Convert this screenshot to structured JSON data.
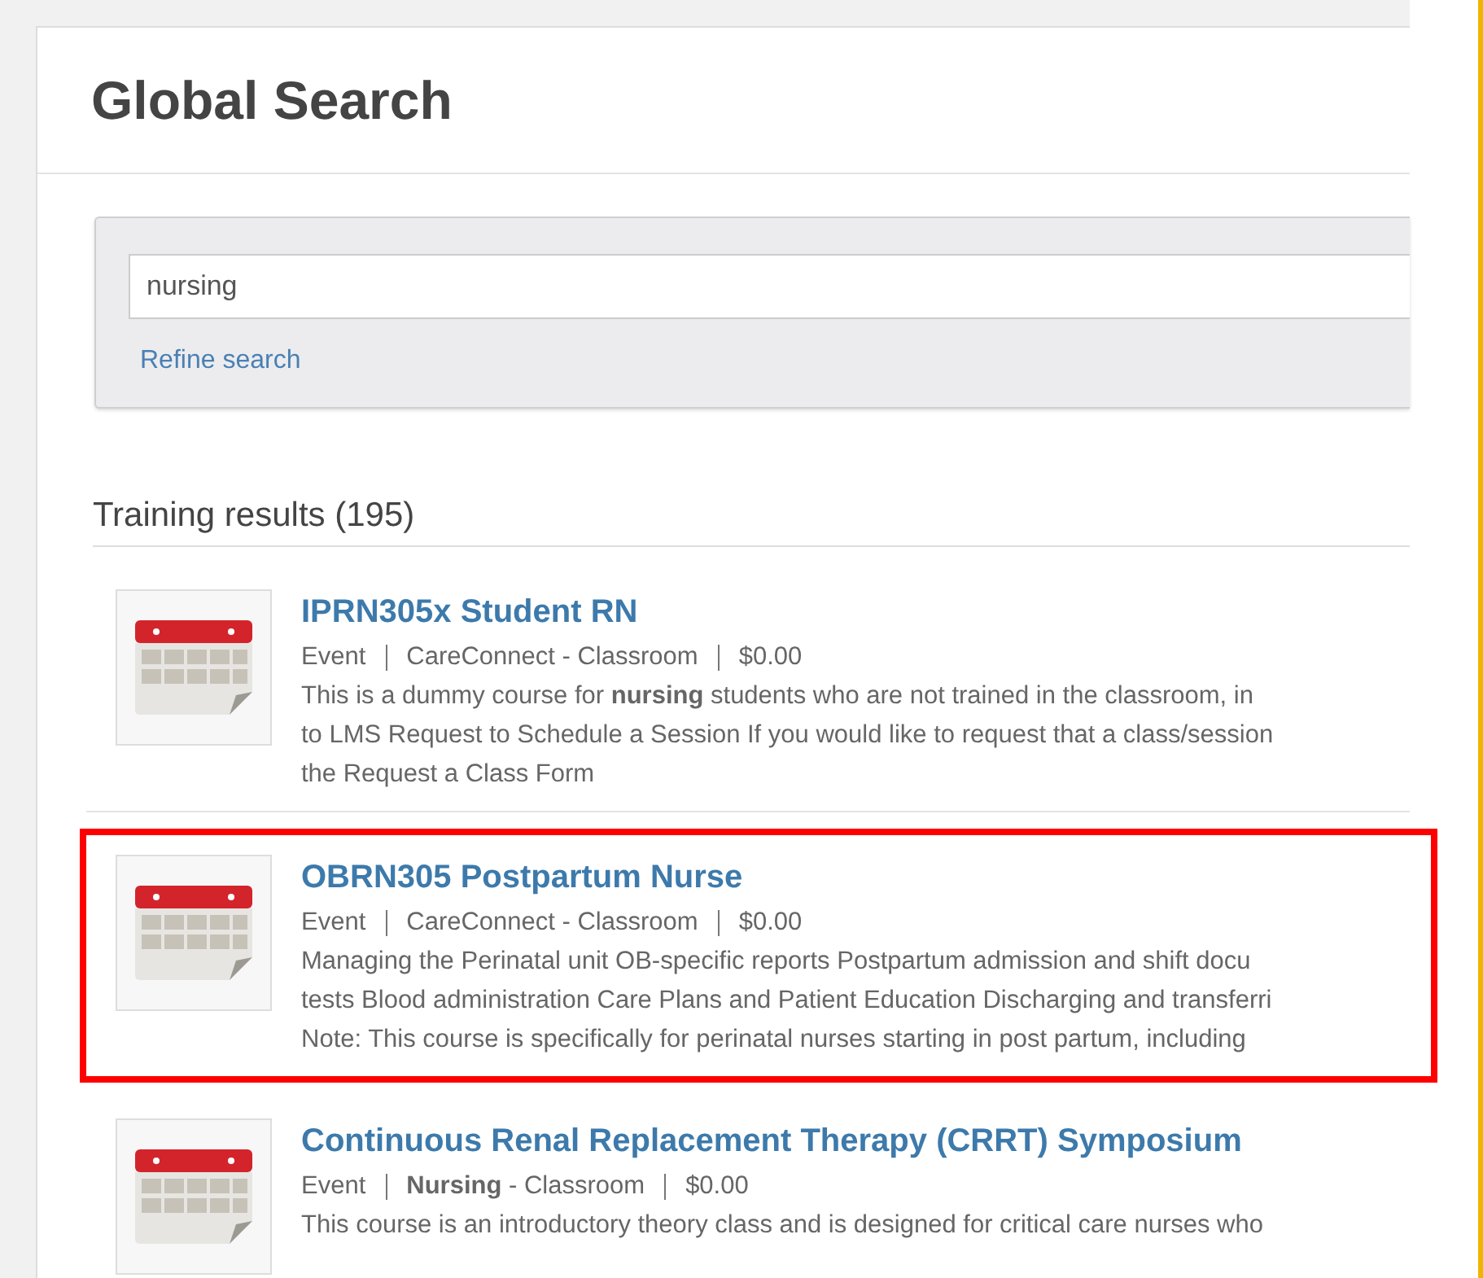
{
  "page": {
    "title": "Global Search"
  },
  "search": {
    "value": "nursing",
    "refine_link": "Refine search"
  },
  "results_heading": "Training results (195)",
  "results": [
    {
      "title": "IPRN305x Student RN",
      "meta": [
        "Event",
        "CareConnect - Classroom",
        "$0.00"
      ],
      "highlighted": false,
      "description": [
        "This is a dummy course for **nursing** students who are not trained in the classroom, in",
        "to LMS Request to Schedule a Session If you would like to request that a class/session",
        "the Request a Class Form"
      ]
    },
    {
      "title": "OBRN305 Postpartum Nurse",
      "meta": [
        "Event",
        "CareConnect - Classroom",
        "$0.00"
      ],
      "highlighted": true,
      "description": [
        "Managing the Perinatal unit OB-specific reports Postpartum admission and shift docu",
        "tests Blood administration Care Plans and Patient Education Discharging and transferri",
        "Note: This course is specifically for perinatal nurses starting in post partum, including"
      ]
    },
    {
      "title": "Continuous Renal Replacement Therapy (CRRT) Symposium",
      "meta": [
        "Event",
        "**Nursing** - Classroom",
        "$0.00"
      ],
      "highlighted": false,
      "description": [
        "This course is an introductory theory class and is designed for critical care nurses who"
      ]
    }
  ]
}
